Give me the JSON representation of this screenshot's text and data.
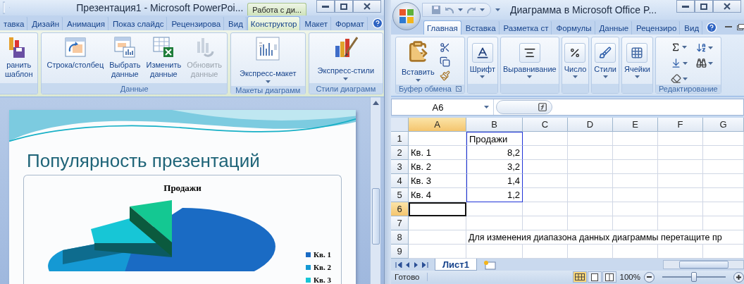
{
  "powerpoint": {
    "title": "Презентация1 - Microsoft PowerPoi...",
    "context_tab": "Работа с ди...",
    "tabs": [
      {
        "label": "тавка",
        "selected": false
      },
      {
        "label": "Дизайн",
        "selected": false
      },
      {
        "label": "Анимация",
        "selected": false
      },
      {
        "label": "Показ слайдс",
        "selected": false
      },
      {
        "label": "Рецензирова",
        "selected": false
      },
      {
        "label": "Вид",
        "selected": false
      },
      {
        "label": "Конструктор",
        "selected": true
      },
      {
        "label": "Макет",
        "selected": false
      },
      {
        "label": "Формат",
        "selected": false
      }
    ],
    "ribbon_groups": [
      {
        "buttons": [
          {
            "label": "ранить шаблон",
            "kind": "large",
            "disabled": false
          }
        ]
      },
      {
        "label": "Данные",
        "buttons": [
          {
            "label": "Строка/столбец",
            "kind": "wide",
            "disabled": false
          },
          {
            "label": "Выбрать данные",
            "kind": "large",
            "disabled": false
          },
          {
            "label": "Изменить данные",
            "kind": "large",
            "disabled": false
          },
          {
            "label": "Обновить данные",
            "kind": "large",
            "disabled": true
          }
        ]
      },
      {
        "label": "Макеты диаграмм",
        "buttons": [
          {
            "label": "Экспресс-макет",
            "kind": "menu",
            "disabled": false
          }
        ]
      },
      {
        "label": "Стили диаграмм",
        "buttons": [
          {
            "label": "Экспресс-стили",
            "kind": "menu",
            "disabled": false
          }
        ]
      }
    ],
    "slide": {
      "title": "Популярность презентаций",
      "chart": {
        "title": "Продажи",
        "legend": [
          {
            "label": "Кв. 1",
            "color": "#1a6bc4"
          },
          {
            "label": "Кв. 2",
            "color": "#1599d4"
          },
          {
            "label": "Кв. 3",
            "color": "#17c6d6"
          }
        ]
      }
    }
  },
  "excel": {
    "title": "Диаграмма в Microsoft Office P...",
    "tabs": [
      {
        "label": "Главная",
        "selected": true
      },
      {
        "label": "Вставка",
        "selected": false
      },
      {
        "label": "Разметка ст",
        "selected": false
      },
      {
        "label": "Формулы",
        "selected": false
      },
      {
        "label": "Данные",
        "selected": false
      },
      {
        "label": "Рецензиро",
        "selected": false
      },
      {
        "label": "Вид",
        "selected": false
      }
    ],
    "ribbon_groups": [
      {
        "label": "Буфер обмена",
        "kind": "clipboard",
        "buttons": [
          "Вставить"
        ]
      },
      {
        "kind": "collapsed",
        "buttons": [
          "Шрифт"
        ]
      },
      {
        "kind": "collapsed",
        "buttons": [
          "Выравнивание"
        ]
      },
      {
        "kind": "collapsed",
        "buttons": [
          "Число"
        ]
      },
      {
        "kind": "collapsed",
        "buttons": [
          "Стили"
        ]
      },
      {
        "kind": "collapsed",
        "buttons": [
          "Ячейки"
        ]
      },
      {
        "label": "Редактирование",
        "kind": "editing"
      }
    ],
    "name_box": "A6",
    "columns": [
      {
        "label": "A",
        "selected": true
      },
      {
        "label": "B",
        "selected": false
      },
      {
        "label": "C",
        "selected": false
      },
      {
        "label": "D",
        "selected": false
      },
      {
        "label": "E",
        "selected": false
      },
      {
        "label": "F",
        "selected": false
      },
      {
        "label": "G",
        "selected": false
      }
    ],
    "rows": [
      {
        "header": "1",
        "selected": false,
        "charted": true,
        "col_b": {
          "text": "Продажи",
          "kind": "text"
        }
      },
      {
        "header": "2",
        "selected": false,
        "charted": true,
        "col_a": "Кв. 1",
        "col_b": {
          "text": "8,2",
          "kind": "number"
        }
      },
      {
        "header": "3",
        "selected": false,
        "charted": true,
        "col_a": "Кв. 2",
        "col_b": {
          "text": "3,2",
          "kind": "number"
        }
      },
      {
        "header": "4",
        "selected": false,
        "charted": true,
        "col_a": "Кв. 3",
        "col_b": {
          "text": "1,4",
          "kind": "number"
        }
      },
      {
        "header": "5",
        "selected": false,
        "charted": true,
        "col_a": "Кв. 4",
        "col_b": {
          "text": "1,2",
          "kind": "number"
        }
      },
      {
        "header": "6",
        "selected": true,
        "charted": false
      },
      {
        "header": "7",
        "selected": false,
        "charted": false
      },
      {
        "header": "8",
        "selected": false,
        "charted": false,
        "col_b": {
          "text": "Для изменения диапазона данных диаграммы перетащите пр",
          "kind": "overflow"
        }
      },
      {
        "header": "9",
        "selected": false,
        "charted": false
      }
    ],
    "sheet_tabs": [
      {
        "label": "Лист1",
        "selected": true
      }
    ],
    "status": "Готово",
    "zoom": {
      "label": "100%",
      "level": 0.5
    }
  }
}
